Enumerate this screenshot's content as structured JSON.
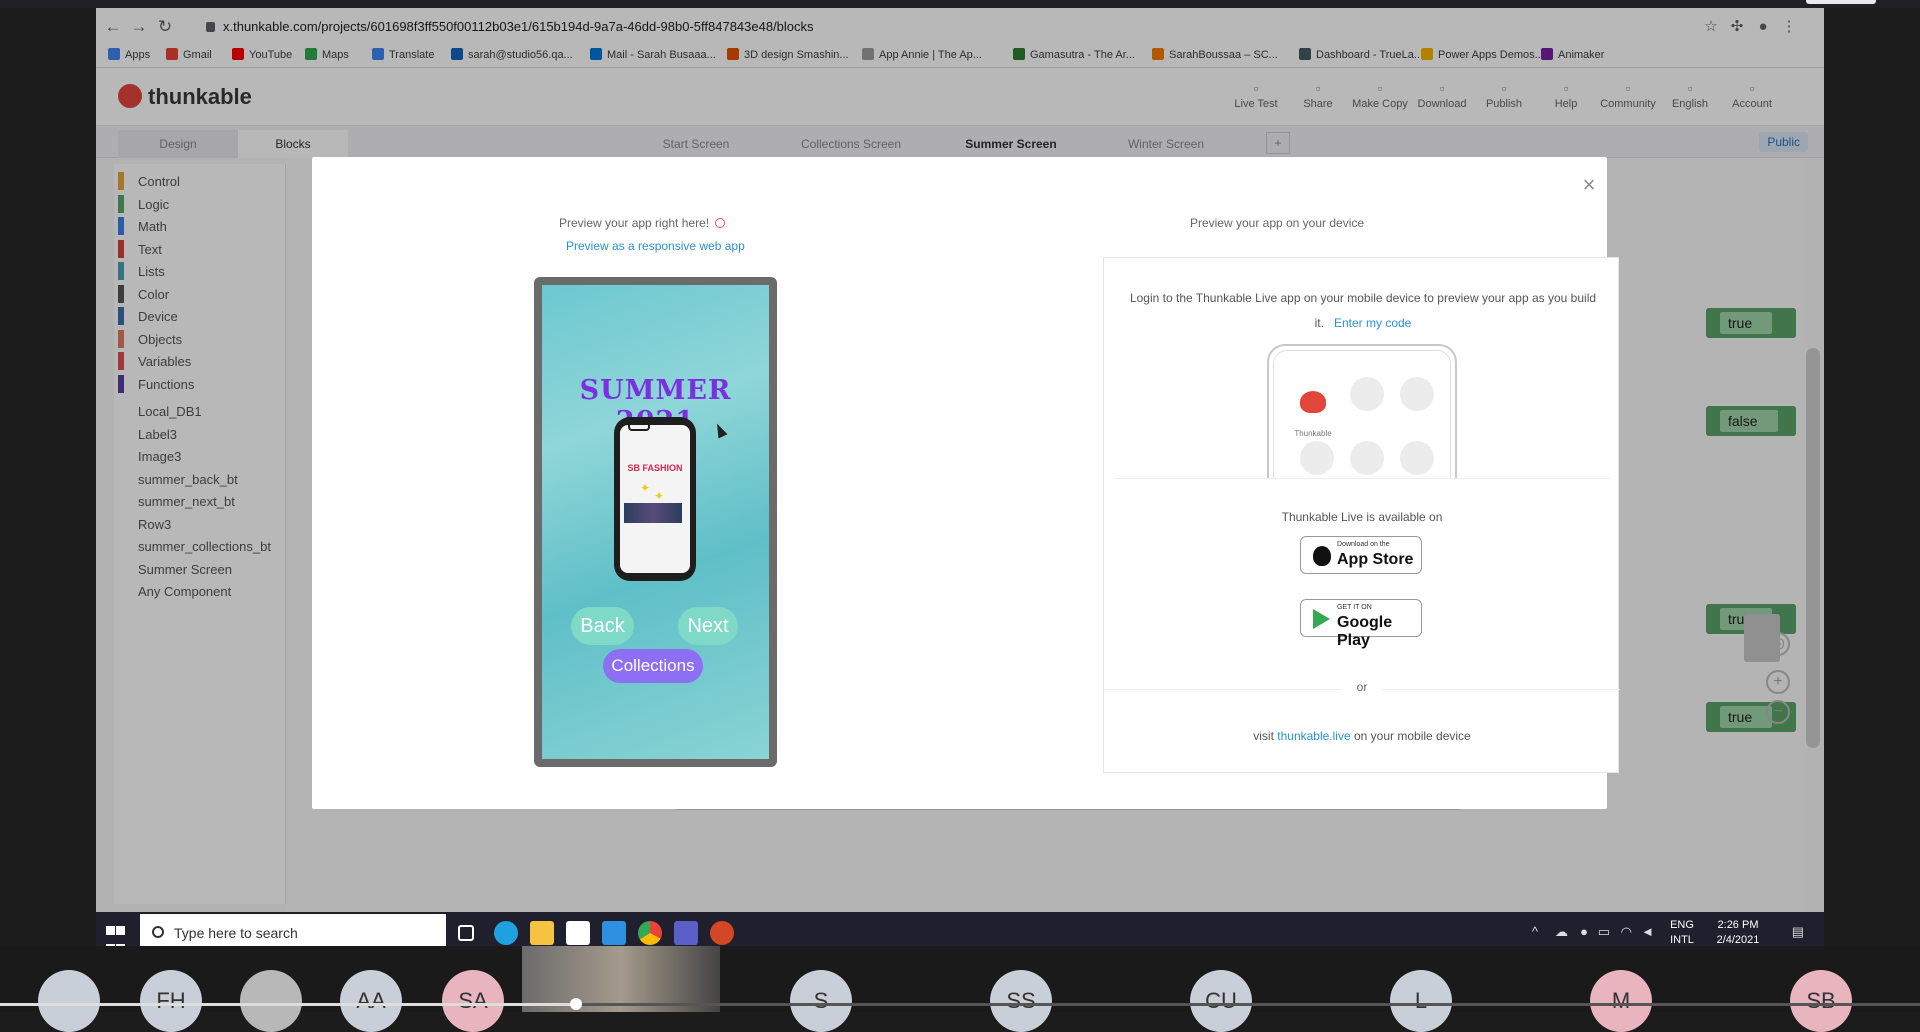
{
  "browser": {
    "url": "x.thunkable.com/projects/601698f3ff550f00112b03e1/615b194d-9a7a-46dd-98b0-5ff847843e48/blocks",
    "bookmarks": [
      "Apps",
      "Gmail",
      "YouTube",
      "Maps",
      "Translate",
      "sarah@studio56.qa...",
      "Mail - Sarah Busaaa...",
      "3D design Smashin...",
      "App Annie | The Ap...",
      "Gamasutra - The Ar...",
      "SarahBoussaa – SC...",
      "Dashboard - TrueLa...",
      "Power Apps Demos...",
      "Animaker"
    ],
    "bookmark_colors": [
      "#4285f4",
      "#ea4335",
      "#ff0000",
      "#34a853",
      "#4285f4",
      "#1565c0",
      "#0078d4",
      "#e65100",
      "#9e9e9e",
      "#2e7d32",
      "#f57c00",
      "#455a64",
      "#f4b400",
      "#7b1fa2"
    ]
  },
  "app": {
    "logo": "thunkable",
    "header_items": [
      {
        "label": "Live Test",
        "icon": "phone-icon"
      },
      {
        "label": "Share",
        "icon": "share-icon"
      },
      {
        "label": "Make Copy",
        "icon": "copy-icon"
      },
      {
        "label": "Download",
        "icon": "download-icon"
      },
      {
        "label": "Publish",
        "icon": "publish-icon"
      },
      {
        "label": "Help",
        "icon": "help-icon"
      },
      {
        "label": "Community",
        "icon": "community-icon"
      },
      {
        "label": "English",
        "icon": "globe-icon"
      },
      {
        "label": "Account",
        "icon": "account-icon"
      }
    ],
    "mode_tabs": [
      "Design",
      "Blocks"
    ],
    "screen_tabs": [
      "Start Screen",
      "Collections Screen",
      "Summer Screen",
      "Winter Screen"
    ],
    "add_screen": "+",
    "public_badge": "Public",
    "block_categories": [
      {
        "label": "Control",
        "color": "#e8a33d"
      },
      {
        "label": "Logic",
        "color": "#5aa46a"
      },
      {
        "label": "Math",
        "color": "#3d7ee8"
      },
      {
        "label": "Text",
        "color": "#d0453a"
      },
      {
        "label": "Lists",
        "color": "#4aa3b0"
      },
      {
        "label": "Color",
        "color": "#555555"
      },
      {
        "label": "Device",
        "color": "#3b6ea8"
      },
      {
        "label": "Objects",
        "color": "#e07a5f"
      },
      {
        "label": "Variables",
        "color": "#e24b4b"
      },
      {
        "label": "Functions",
        "color": "#5b3fa0"
      }
    ],
    "components": [
      "Local_DB1",
      "Label3",
      "Image3",
      "summer_back_bt",
      "summer_next_bt",
      "Row3",
      "summer_collections_bt",
      "Summer Screen",
      "Any Component"
    ],
    "canvas_blocks": [
      "true",
      "false",
      "true",
      "true"
    ]
  },
  "modal": {
    "left_header": "Preview your app right here!",
    "left_link": "Preview as a responsive web app",
    "phone": {
      "title": "SUMMER 2021",
      "mini_brand": "SB FASHION",
      "back": "Back",
      "next": "Next",
      "collections": "Collections"
    },
    "right_header": "Preview your app on your device",
    "login_text": "Login to the Thunkable Live app on your mobile device to preview your app as you build it.",
    "enter_code": "Enter my code",
    "device_app_label": "Thunkable",
    "available_on": "Thunkable Live is available on",
    "appstore_small": "Download on the",
    "appstore_big": "App Store",
    "gplay_small": "GET IT ON",
    "gplay_big": "Google Play",
    "or": "or",
    "visit_prefix": "visit",
    "visit_link": "thunkable.live",
    "visit_suffix": "on your mobile device",
    "close": "×"
  },
  "taskbar": {
    "search_placeholder": "Type here to search",
    "lang": "ENG",
    "lang2": "INTL",
    "time": "2:26 PM",
    "date": "2/4/2021"
  },
  "participants": [
    "",
    "FH",
    "",
    "AA",
    "SA",
    "S",
    "SS",
    "CU",
    "L",
    "M",
    "SB"
  ],
  "meeting_progress": 0.3
}
